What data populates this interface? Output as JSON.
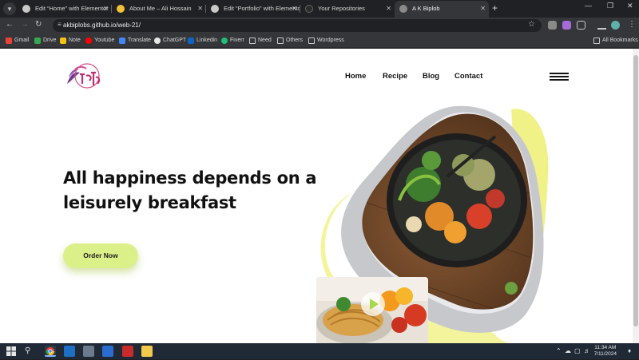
{
  "browser": {
    "tabs": [
      {
        "title": "Edit “Home” with Elementor",
        "favicon": "wordpress-icon",
        "active": false
      },
      {
        "title": "About Me – Ali Hossain",
        "favicon": "site-icon",
        "active": false
      },
      {
        "title": "Edit “Portfolio” with Elementor",
        "favicon": "wordpress-icon",
        "active": false
      },
      {
        "title": "Your Repositories",
        "favicon": "github-icon",
        "active": false
      },
      {
        "title": "A K Biplob",
        "favicon": "globe-icon",
        "active": true
      }
    ],
    "url": "akbiplobs.github.io/web-21/",
    "bookmarks": [
      {
        "label": "Gmail",
        "icon": "gmail-icon"
      },
      {
        "label": "Drive",
        "icon": "drive-icon"
      },
      {
        "label": "Note",
        "icon": "note-icon"
      },
      {
        "label": "Youtube",
        "icon": "youtube-icon"
      },
      {
        "label": "Translate",
        "icon": "translate-icon"
      },
      {
        "label": "ChatGPT",
        "icon": "chatgpt-icon"
      },
      {
        "label": "Linkedin",
        "icon": "linkedin-icon"
      },
      {
        "label": "Fiverr",
        "icon": "fiverr-icon"
      },
      {
        "label": "Need",
        "icon": "folder-icon"
      },
      {
        "label": "Others",
        "icon": "folder-icon"
      },
      {
        "label": "Wordpress",
        "icon": "folder-icon"
      }
    ],
    "all_bookmarks": "All Bookmarks"
  },
  "site": {
    "nav": [
      "Home",
      "Recipe",
      "Blog",
      "Contact"
    ],
    "headline_line1": "All happiness depends on a",
    "headline_line2": "leisurely breakfast",
    "cta": "Order Now",
    "accent_color": "#dcf08a"
  },
  "taskbar": {
    "time": "11:34 AM",
    "date": "7/11/2024"
  }
}
